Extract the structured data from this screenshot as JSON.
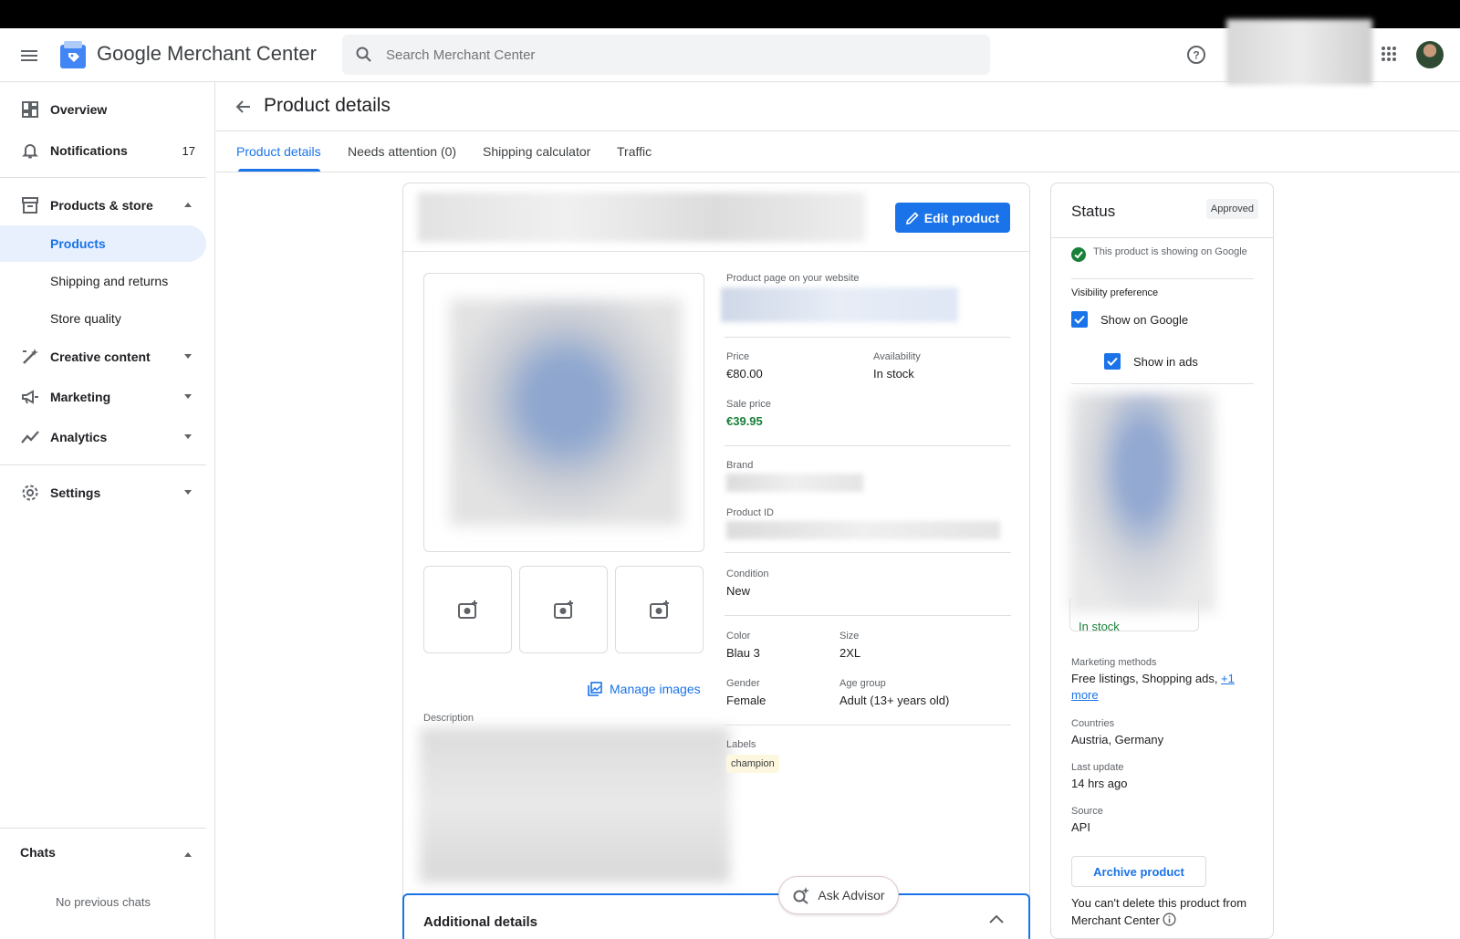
{
  "header": {
    "brand": "Google Merchant Center",
    "search_placeholder": "Search Merchant Center"
  },
  "sidebar": {
    "overview": "Overview",
    "notifications": "Notifications",
    "notifications_count": "17",
    "products_store": "Products & store",
    "products": "Products",
    "shipping_returns": "Shipping and returns",
    "store_quality": "Store quality",
    "creative_content": "Creative content",
    "marketing": "Marketing",
    "analytics": "Analytics",
    "settings": "Settings",
    "chats": "Chats",
    "no_chats": "No previous chats"
  },
  "page": {
    "title": "Product details"
  },
  "tabs": {
    "product_details": "Product details",
    "needs_attention": "Needs attention (0)",
    "shipping_calculator": "Shipping calculator",
    "traffic": "Traffic"
  },
  "product": {
    "edit_label": "Edit product",
    "manage_images": "Manage images",
    "description_label": "Description",
    "page_label": "Product page on your website",
    "price_label": "Price",
    "price": "€80.00",
    "availability_label": "Availability",
    "availability": "In stock",
    "sale_price_label": "Sale price",
    "sale_price": "€39.95",
    "brand_label": "Brand",
    "product_id_label": "Product ID",
    "condition_label": "Condition",
    "condition": "New",
    "color_label": "Color",
    "color": "Blau 3",
    "size_label": "Size",
    "size": "2XL",
    "gender_label": "Gender",
    "gender": "Female",
    "age_group_label": "Age group",
    "age_group": "Adult (13+ years old)",
    "labels_label": "Labels",
    "label_chip": "champion",
    "additional_details": "Additional details",
    "ask_advisor": "Ask Advisor"
  },
  "status": {
    "title": "Status",
    "badge": "Approved",
    "showing": "This product is showing on Google",
    "visibility_label": "Visibility preference",
    "show_on_google": "Show on Google",
    "show_in_ads": "Show in ads",
    "in_stock": "In stock",
    "marketing_label": "Marketing methods",
    "marketing_value": "Free listings, Shopping ads, ",
    "marketing_more": "+1 more",
    "countries_label": "Countries",
    "countries": "Austria, Germany",
    "last_update_label": "Last update",
    "last_update": "14 hrs ago",
    "source_label": "Source",
    "source": "API",
    "archive": "Archive product",
    "cant_delete": "You can't delete this product from Merchant Center"
  },
  "colors": {
    "accent": "#1a73e8",
    "success": "#188038"
  }
}
